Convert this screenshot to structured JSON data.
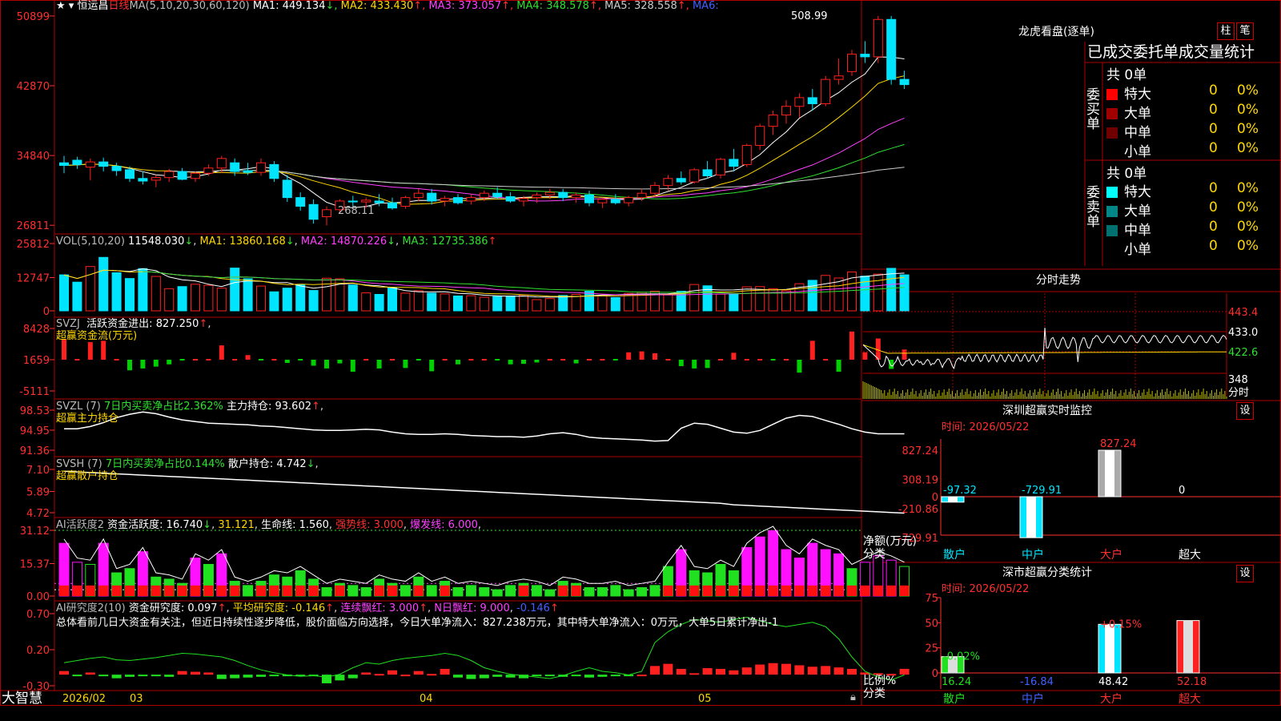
{
  "header": {
    "stock_name": "恒运昌",
    "period": "日线",
    "ma_label": "MA(5,10,20,30,60,120)",
    "ma": [
      {
        "label": "MA1:",
        "value": "449.134",
        "arrow": "↓",
        "color": "#ffffff"
      },
      {
        "label": "MA2:",
        "value": "433.430",
        "arrow": "↑",
        "color": "#ffd700"
      },
      {
        "label": "MA3:",
        "value": "373.057",
        "arrow": "↑",
        "color": "#ff40ff"
      },
      {
        "label": "MA4:",
        "value": "348.578",
        "arrow": "↑",
        "color": "#30e030"
      },
      {
        "label": "MA5:",
        "value": "328.558",
        "arrow": "↑",
        "color": "#cccccc"
      },
      {
        "label": "MA6:",
        "value": "",
        "arrow": "",
        "color": "#4060ff"
      }
    ]
  },
  "price_panel": {
    "y_ticks": [
      "50899",
      "42870",
      "34840",
      "26811"
    ],
    "high_label": "508.99",
    "low_label": "268.11"
  },
  "vol_panel": {
    "label": "VOL(5,10,20)",
    "value": "11548.030",
    "ma1": "13860.168",
    "ma2": "14870.226",
    "ma3": "12735.386",
    "y_ticks": [
      "25812",
      "12747",
      "0"
    ]
  },
  "svzj_panel": {
    "label": "SVZJ",
    "text": "活跃资金进出:",
    "value": "827.250",
    "sub": "超赢资金流(万元)",
    "y_ticks": [
      "8428",
      "1659",
      "-5111"
    ]
  },
  "svzl_panel": {
    "label": "SVZL (7)",
    "text": "7日内买卖净占比2.362%",
    "text2": "主力持仓:",
    "value": "93.602",
    "sub": "超赢主力持仓",
    "y_ticks": [
      "98.53",
      "94.95",
      "91.36"
    ]
  },
  "svsh_panel": {
    "label": "SVSH (7)",
    "text": "7日内买卖净占比0.144%",
    "text2": "散户持仓:",
    "value": "4.742",
    "sub": "超赢散户持仓",
    "y_ticks": [
      "7.10",
      "5.89",
      "4.72"
    ]
  },
  "ai_active_panel": {
    "label": "AI活跃度2",
    "t1": "资金活跃度:",
    "v1": "16.740",
    "v2": "31.121",
    "t3": "生命线:",
    "v3": "1.560",
    "t4": "强势线:",
    "v4": "3.000",
    "t5": "爆发线:",
    "v5": "6.000",
    "y_ticks": [
      "31.12",
      "15.37",
      "0.00"
    ]
  },
  "ai_research_panel": {
    "label": "AI研究度2(10)",
    "t1": "资金研究度:",
    "v1": "0.097",
    "t2": "平均研究度:",
    "v2": "-0.146",
    "t3": "连续飘红:",
    "v3": "3.000",
    "t4": "N日飘红:",
    "v4": "9.000",
    "v5": "-0.146",
    "summary": "总体看前几日大资金有关注，但近日持续性逐步降低，股价面临方向选择，今日大单净流入：827.238万元，其中特大单净流入：0万元，大单5日累计净出-1",
    "y_ticks": [
      "0.70",
      "0.20",
      "-0.30"
    ]
  },
  "x_axis": {
    "brand": "大智慧",
    "labels": [
      "2026/02",
      "03",
      "04",
      "05"
    ]
  },
  "chart_data": [
    {
      "type": "candlestick",
      "title": "恒运昌 日线",
      "y_ticks": [
        268.11,
        348.4,
        428.7,
        508.99
      ],
      "ylim": [
        268.11,
        508.99
      ],
      "x_labels": [
        "2026/02",
        "03",
        "04",
        "05"
      ],
      "ohlc": [
        [
          340,
          348,
          328,
          337
        ],
        [
          343,
          347,
          333,
          338
        ],
        [
          335,
          345,
          320,
          341
        ],
        [
          341,
          346,
          330,
          336
        ],
        [
          336,
          340,
          325,
          331
        ],
        [
          332,
          336,
          318,
          322
        ],
        [
          322,
          330,
          315,
          319
        ],
        [
          320,
          326,
          312,
          323
        ],
        [
          323,
          333,
          318,
          330
        ],
        [
          330,
          334,
          320,
          321
        ],
        [
          322,
          330,
          318,
          328
        ],
        [
          328,
          338,
          325,
          334
        ],
        [
          334,
          348,
          328,
          345
        ],
        [
          340,
          345,
          325,
          330
        ],
        [
          331,
          340,
          326,
          329
        ],
        [
          329,
          345,
          325,
          340
        ],
        [
          338,
          342,
          318,
          322
        ],
        [
          320,
          326,
          295,
          300
        ],
        [
          300,
          306,
          285,
          290
        ],
        [
          292,
          298,
          270,
          275
        ],
        [
          278,
          290,
          268,
          286
        ],
        [
          286,
          298,
          282,
          296
        ],
        [
          296,
          302,
          290,
          295
        ],
        [
          295,
          300,
          288,
          297
        ],
        [
          296,
          304,
          290,
          294
        ],
        [
          294,
          300,
          286,
          288
        ],
        [
          290,
          302,
          287,
          300
        ],
        [
          300,
          310,
          296,
          305
        ],
        [
          305,
          310,
          292,
          296
        ],
        [
          296,
          302,
          290,
          299
        ],
        [
          300,
          304,
          292,
          294
        ],
        [
          296,
          304,
          292,
          300
        ],
        [
          300,
          308,
          296,
          305
        ],
        [
          305,
          312,
          298,
          301
        ],
        [
          301,
          306,
          294,
          296
        ],
        [
          296,
          302,
          290,
          299
        ],
        [
          300,
          306,
          294,
          303
        ],
        [
          303,
          310,
          298,
          306
        ],
        [
          306,
          310,
          296,
          300
        ],
        [
          300,
          306,
          294,
          303
        ],
        [
          303,
          308,
          290,
          294
        ],
        [
          294,
          300,
          288,
          298
        ],
        [
          298,
          304,
          292,
          294
        ],
        [
          294,
          302,
          290,
          300
        ],
        [
          300,
          310,
          296,
          305
        ],
        [
          305,
          318,
          300,
          314
        ],
        [
          314,
          326,
          308,
          322
        ],
        [
          322,
          330,
          315,
          318
        ],
        [
          318,
          334,
          316,
          332
        ],
        [
          332,
          342,
          322,
          325
        ],
        [
          326,
          346,
          322,
          344
        ],
        [
          344,
          356,
          330,
          336
        ],
        [
          338,
          362,
          335,
          360
        ],
        [
          360,
          385,
          355,
          382
        ],
        [
          382,
          400,
          372,
          395
        ],
        [
          395,
          412,
          385,
          405
        ],
        [
          405,
          420,
          392,
          415
        ],
        [
          415,
          425,
          400,
          408
        ],
        [
          408,
          440,
          405,
          436
        ],
        [
          436,
          460,
          430,
          440
        ],
        [
          445,
          470,
          440,
          465
        ],
        [
          465,
          480,
          455,
          462
        ],
        [
          462,
          508.99,
          455,
          505
        ],
        [
          505,
          509,
          430,
          436
        ],
        [
          436,
          446,
          425,
          430
        ]
      ]
    },
    {
      "type": "bar",
      "title": "VOL(5,10,20)",
      "ylim": [
        0,
        25812
      ],
      "y_ticks": [
        0,
        12747,
        25812
      ],
      "values": [
        13800,
        11000,
        17000,
        20500,
        14600,
        12400,
        16200,
        13200,
        8500,
        9300,
        10200,
        9800,
        8700,
        16400,
        12300,
        9500,
        7300,
        8700,
        10000,
        7800,
        12500,
        12300,
        9900,
        6900,
        6300,
        8900,
        6800,
        7700,
        6800,
        6500,
        5700,
        5800,
        5200,
        5500,
        5700,
        6100,
        4300,
        4700,
        5900,
        6300,
        7500,
        6000,
        5100,
        6700,
        7100,
        7500,
        6300,
        7500,
        10100,
        9600,
        6400,
        6500,
        9200,
        9300,
        8500,
        7700,
        10400,
        11700,
        13600,
        12600,
        14900,
        13300,
        14100,
        16300,
        13800
      ]
    },
    {
      "type": "bar",
      "title": "SVZJ 活跃资金进出 (万元)",
      "ylim": [
        -5111,
        8428
      ],
      "y_ticks": [
        -5111,
        1659,
        8428
      ],
      "values": [
        4500,
        0,
        3800,
        4100,
        0,
        -2300,
        -1900,
        -1500,
        -1000,
        0,
        0,
        0,
        3100,
        0,
        1000,
        0,
        0,
        -700,
        0,
        -1300,
        -1900,
        -800,
        -2600,
        0,
        -1900,
        0,
        -1800,
        0,
        -2500,
        0,
        -1000,
        0,
        0,
        0,
        -1000,
        -900,
        -600,
        0,
        0,
        -800,
        0,
        0,
        0,
        1600,
        1800,
        1400,
        0,
        -1400,
        -1900,
        -1800,
        0,
        1500,
        0,
        0,
        0,
        0,
        -2800,
        4100,
        0,
        -2600,
        6100,
        1600,
        4600,
        -2000,
        2200
      ]
    }
  ],
  "right_top": {
    "title": "龙虎看盘(逐单)",
    "btn1": "柱",
    "btn2": "笔",
    "col_header": "已成交委托单成交量统计",
    "buy_label": "委买单",
    "sell_label": "委卖单",
    "buy_total": "共 0单",
    "sell_total": "共 0单",
    "buy_rows": [
      {
        "name": "特大",
        "n": "0",
        "p": "0%",
        "color": "#ff0000"
      },
      {
        "name": "大单",
        "n": "0",
        "p": "0%",
        "color": "#a00000"
      },
      {
        "name": "中单",
        "n": "0",
        "p": "0%",
        "color": "#700000"
      },
      {
        "name": "小单",
        "n": "0",
        "p": "0%",
        "color": ""
      }
    ],
    "sell_rows": [
      {
        "name": "特大",
        "n": "0",
        "p": "0%",
        "color": "#00ffff"
      },
      {
        "name": "大单",
        "n": "0",
        "p": "0%",
        "color": "#008888"
      },
      {
        "name": "中单",
        "n": "0",
        "p": "0%",
        "color": "#007070"
      },
      {
        "name": "小单",
        "n": "0",
        "p": "0%",
        "color": ""
      }
    ]
  },
  "minute_panel": {
    "title": "分时走势",
    "price_ticks": [
      "443.4",
      "433.0",
      "422.6"
    ],
    "vol_tick": "348",
    "vol_label": "分时"
  },
  "monitor_panel": {
    "title": "深圳超赢实时监控",
    "btn": "设",
    "time": "时间: 2026/05/22",
    "y_ticks": [
      "827.24",
      "308.19",
      "0",
      "-210.86",
      "-729.91"
    ],
    "y_label": "净额(万元)",
    "x_label": "分类",
    "categories": [
      "散户",
      "中户",
      "大户",
      "超大"
    ],
    "values": [
      -97.32,
      -729.91,
      827.24,
      0
    ],
    "value_labels": [
      "-97.32",
      "-729.91",
      "827.24",
      "0"
    ]
  },
  "stats_panel": {
    "title": "深市超赢分类统计",
    "btn": "设",
    "time": "时间: 2026/05/22",
    "y_ticks": [
      "75",
      "50",
      "25",
      "0"
    ],
    "y_label": "比例%",
    "x_label": "分类",
    "categories": [
      "散户",
      "中户",
      "大户",
      "超大"
    ],
    "values": [
      16.24,
      -16.84,
      48.42,
      52.18
    ],
    "changes": [
      "-0.02%",
      "",
      "+0.15%",
      ""
    ],
    "value_labels": [
      "16.24",
      "-16.84",
      "48.42",
      "52.18"
    ]
  }
}
